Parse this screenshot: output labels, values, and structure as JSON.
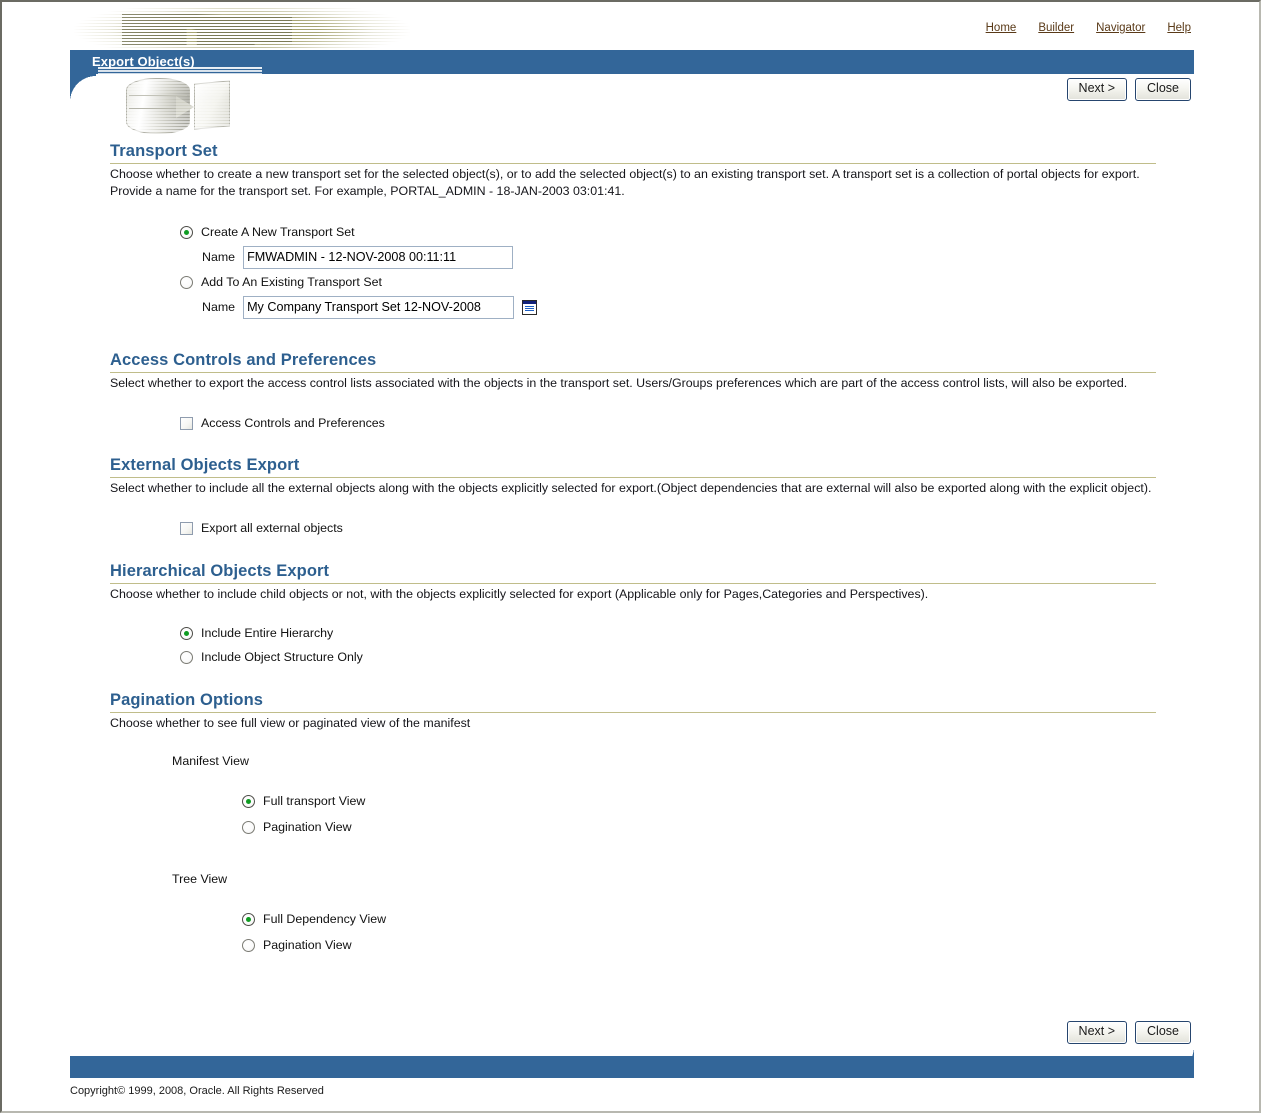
{
  "window": {
    "title": "Export Object(s)"
  },
  "topnav": {
    "items": [
      {
        "label": "Home",
        "name": "nav-home"
      },
      {
        "label": "Builder",
        "name": "nav-builder"
      },
      {
        "label": "Navigator",
        "name": "nav-navigator"
      },
      {
        "label": "Help",
        "name": "nav-help"
      }
    ]
  },
  "toolbar": {
    "next_label": "Next >",
    "close_label": "Close"
  },
  "sections": {
    "transport_set": {
      "title": "Transport Set",
      "description": "Choose whether to create a new transport set for the selected object(s), or to add the selected object(s) to an existing transport set. A transport set is a collection of portal objects for export. Provide a name for the transport set. For example, PORTAL_ADMIN - 18-JAN-2003 03:01:41.",
      "create_option_label": "Create A New Transport Set",
      "create_option_selected": true,
      "create_name_label": "Name",
      "create_name_value": "FMWADMIN - 12-NOV-2008 00:11:11",
      "add_option_label": "Add To An Existing Transport Set",
      "add_option_selected": false,
      "add_name_label": "Name",
      "add_name_value": "My Company Transport Set 12-NOV-2008",
      "browse_icon": "list-browse-icon"
    },
    "access_controls": {
      "title": "Access Controls and Preferences",
      "description": "Select whether to export the access control lists associated with the objects in the transport set. Users/Groups preferences which are part of the access control lists, will also be exported.",
      "checkbox_label": "Access Controls and Preferences",
      "checkbox_checked": false
    },
    "external_objects": {
      "title": "External Objects Export",
      "description": "Select whether to include all the external objects along with the objects explicitly selected for export.(Object dependencies that are external will also be exported along with the explicit object).",
      "checkbox_label": "Export all external objects",
      "checkbox_checked": false
    },
    "hierarchical_objects": {
      "title": "Hierarchical Objects Export",
      "description": "Choose whether to include child objects or not, with the objects explicitly selected for export (Applicable only for Pages,Categories and Perspectives).",
      "option_entire_label": "Include Entire Hierarchy",
      "option_entire_selected": true,
      "option_structure_label": "Include Object Structure Only",
      "option_structure_selected": false
    },
    "pagination_options": {
      "title": "Pagination Options",
      "description": "Choose whether to see full view or paginated view of the manifest",
      "manifest_view_label": "Manifest View",
      "manifest_full_label": "Full transport View",
      "manifest_full_selected": true,
      "manifest_pagination_label": "Pagination View",
      "manifest_pagination_selected": false,
      "tree_view_label": "Tree View",
      "tree_full_label": "Full Dependency View",
      "tree_full_selected": true,
      "tree_pagination_label": "Pagination View",
      "tree_pagination_selected": false
    }
  },
  "footer": {
    "copyright": "Copyright© 1999, 2008, Oracle. All Rights Reserved"
  },
  "colors": {
    "bar_blue": "#336699",
    "heading_blue": "#2d5f8f",
    "rule_olive": "#c0bd8a",
    "radio_dot_green": "#0f9c22",
    "link_brown": "#5a3a18"
  }
}
